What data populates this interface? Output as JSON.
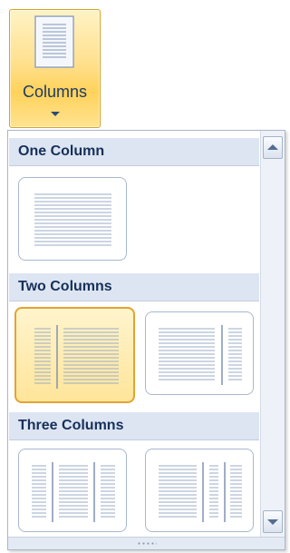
{
  "ribbon_button": {
    "label": "Columns",
    "icon": "document-columns-icon"
  },
  "gallery": {
    "sections": [
      {
        "title": "One Column",
        "items": [
          {
            "name": "one-column",
            "columns": 1,
            "layout": "equal",
            "selected": false
          }
        ]
      },
      {
        "title": "Two Columns",
        "items": [
          {
            "name": "two-columns",
            "columns": 2,
            "layout": "equal",
            "selected": true
          },
          {
            "name": "two-columns-left-narrow",
            "columns": 2,
            "layout": "right-narrow",
            "selected": false
          }
        ]
      },
      {
        "title": "Three Columns",
        "items": [
          {
            "name": "three-columns",
            "columns": 3,
            "layout": "equal",
            "selected": false
          },
          {
            "name": "three-columns-variant",
            "columns": 3,
            "layout": "right-wide",
            "selected": false
          }
        ]
      }
    ],
    "scroll_up_icon": "scroll-up-arrow-icon",
    "scroll_down_icon": "scroll-down-arrow-icon",
    "resize_icon": "resize-grip-icon"
  },
  "colors": {
    "accent": "#ffd25a",
    "selected_border": "#e3a331",
    "header_bg": "#dde5f2",
    "header_text": "#17305a",
    "line": "#9aabc6"
  }
}
